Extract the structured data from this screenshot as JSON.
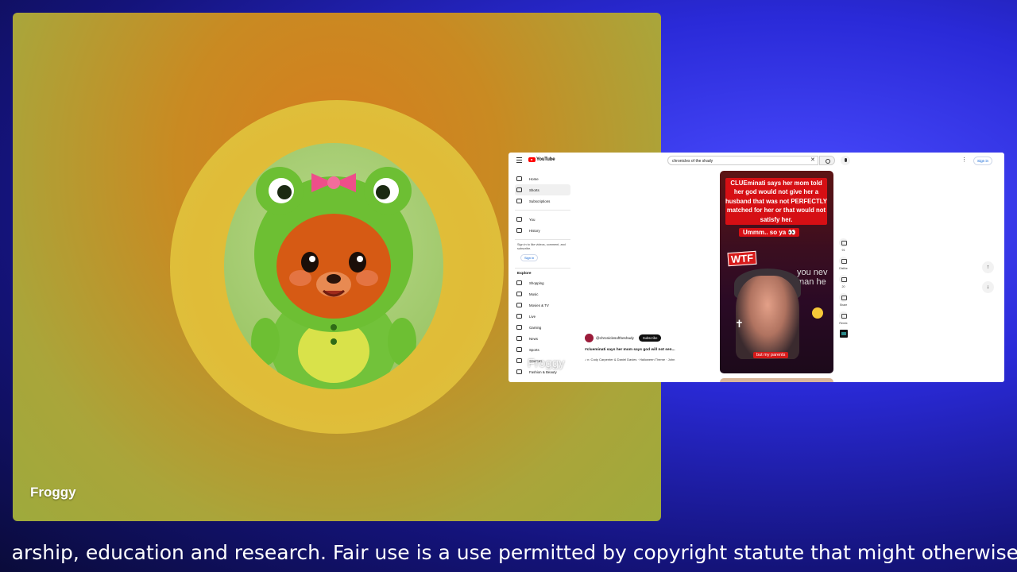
{
  "participant": {
    "name": "Froggy"
  },
  "watermark": {
    "label": "Froggy"
  },
  "youtube": {
    "logo": "YouTube",
    "search_value": "chronicles of the shady",
    "signin_top": "Sign in",
    "nav": {
      "items": [
        "Home",
        "Shorts",
        "Subscriptions"
      ],
      "you_items": [
        "You",
        "History"
      ],
      "signin_note": "Sign in to like videos, comment, and subscribe.",
      "signin_button": "Sign in",
      "explore_heading": "Explore",
      "explore_items": [
        "Shopping",
        "Music",
        "Movies & TV",
        "Live",
        "Gaming",
        "News",
        "Sports",
        "Courses",
        "Fashion & Beauty"
      ]
    },
    "short": {
      "caption": "CLUEminati says her mom told her god would not give her a husband that was not PERFECTLY matched for her or that would not satisfy her.",
      "caption2": "Ummm.. so ya 👀",
      "wtf": "WTF",
      "bg_text": "you nev man he",
      "subtitle": "but my parents"
    },
    "actions": {
      "like_count": "91",
      "dislike": "Dislike",
      "comments": "20",
      "share": "Share",
      "remix": "Remix"
    },
    "meta": {
      "channel": "@chroniclesoftheshady",
      "subscribe": "Subscribe",
      "title": "#clueminati says her mom says god will not sen...",
      "music": "♪ n: Cody Carpenter & Daniel Davies · Halloween Theme · John"
    }
  },
  "ticker": {
    "text": "arship, education and research. Fair use is a use permitted by copyright statute that might otherwise"
  }
}
